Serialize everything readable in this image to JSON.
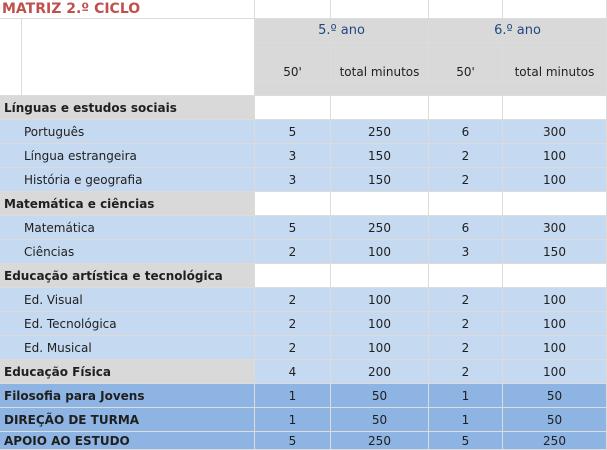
{
  "title": "MATRIZ 2.º CICLO",
  "years": [
    "5.º ano",
    "6.º ano"
  ],
  "columns": [
    "50'",
    "total minutos",
    "50'",
    "total minutos"
  ],
  "rows": [
    {
      "kind": "cat",
      "label": "Línguas e estudos sociais",
      "v": [
        "",
        "",
        "",
        ""
      ]
    },
    {
      "kind": "sub",
      "label": "Português",
      "v": [
        "5",
        "250",
        "6",
        "300"
      ]
    },
    {
      "kind": "sub",
      "label": "Língua estrangeira",
      "v": [
        "3",
        "150",
        "2",
        "100"
      ]
    },
    {
      "kind": "sub",
      "label": "História e geografia",
      "v": [
        "3",
        "150",
        "2",
        "100"
      ]
    },
    {
      "kind": "cat",
      "label": "Matemática e ciências",
      "v": [
        "",
        "",
        "",
        ""
      ]
    },
    {
      "kind": "sub",
      "label": "Matemática",
      "v": [
        "5",
        "250",
        "6",
        "300"
      ]
    },
    {
      "kind": "sub",
      "label": "Ciências",
      "v": [
        "2",
        "100",
        "3",
        "150"
      ]
    },
    {
      "kind": "cat",
      "label": "Educação artística e tecnológica",
      "v": [
        "",
        "",
        "",
        ""
      ]
    },
    {
      "kind": "sub",
      "label": "Ed. Visual",
      "v": [
        "2",
        "100",
        "2",
        "100"
      ]
    },
    {
      "kind": "sub",
      "label": "Ed. Tecnológica",
      "v": [
        "2",
        "100",
        "2",
        "100"
      ]
    },
    {
      "kind": "sub",
      "label": "Ed. Musical",
      "v": [
        "2",
        "100",
        "2",
        "100"
      ]
    },
    {
      "kind": "cat",
      "label": "Educação Física",
      "v": [
        "4",
        "200",
        "2",
        "100"
      ]
    },
    {
      "kind": "dark",
      "label": "Filosofia para Jovens",
      "v": [
        "1",
        "50",
        "1",
        "50"
      ]
    },
    {
      "kind": "dark",
      "label": "DIREÇÃO DE TURMA",
      "v": [
        "1",
        "50",
        "1",
        "50"
      ]
    },
    {
      "kind": "dark",
      "label": "APOIO AO ESTUDO",
      "v": [
        "5",
        "250",
        "5",
        "250"
      ]
    }
  ],
  "colors": {
    "title": "#c0504d",
    "year": "#1f497d",
    "category": "#d9d9d9",
    "subject": "#c5d9f1",
    "highlight": "#8db4e2"
  }
}
